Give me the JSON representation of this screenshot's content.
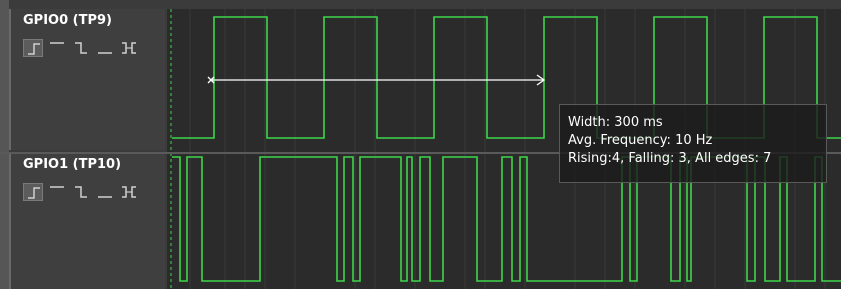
{
  "channels": [
    {
      "name": "GPIO0 (TP9)",
      "trigger_icons": [
        "rising-edge-icon",
        "high-level-icon",
        "falling-edge-icon",
        "low-level-icon",
        "any-edge-icon"
      ],
      "selected_trigger": "rising-edge-icon"
    },
    {
      "name": "GPIO1 (TP10)",
      "trigger_icons": [
        "rising-edge-icon",
        "high-level-icon",
        "falling-edge-icon",
        "low-level-icon",
        "any-edge-icon"
      ],
      "selected_trigger": "rising-edge-icon"
    }
  ],
  "measurement": {
    "width": "Width: 300 ms",
    "frequency": "Avg. Frequency: 10 Hz",
    "edges": "Rising:4, Falling: 3, All edges: 7"
  },
  "colors": {
    "signal": "#3dd64a",
    "background": "#2b2b2b",
    "panel": "#3f3f3f",
    "marker": "#ffffff"
  }
}
